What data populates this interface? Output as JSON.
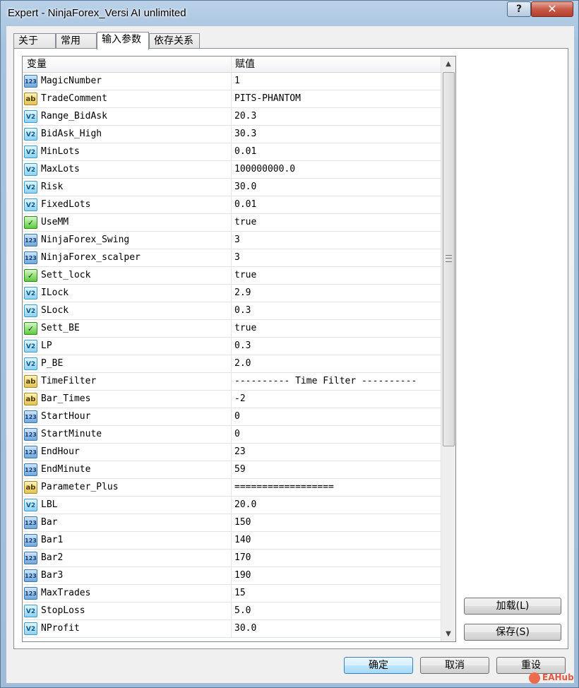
{
  "window": {
    "title": "Expert - NinjaForex_Versi AI unlimited",
    "help_label": "?",
    "close_label": "✕"
  },
  "tabs": [
    {
      "label": "关于"
    },
    {
      "label": "常用"
    },
    {
      "label": "输入参数",
      "active": true
    },
    {
      "label": "依存关系"
    }
  ],
  "grid": {
    "header": {
      "variable": "变量",
      "value": "赋值"
    },
    "rows": [
      {
        "type": "int",
        "icon": "123",
        "name": "MagicNumber",
        "value": "1"
      },
      {
        "type": "str",
        "icon": "ab",
        "name": "TradeComment",
        "value": "PITS-PHANTOM"
      },
      {
        "type": "dbl",
        "icon": "V2",
        "name": "Range_BidAsk",
        "value": "20.3"
      },
      {
        "type": "dbl",
        "icon": "V2",
        "name": "BidAsk_High",
        "value": "30.3"
      },
      {
        "type": "dbl",
        "icon": "V2",
        "name": "MinLots",
        "value": "0.01"
      },
      {
        "type": "dbl",
        "icon": "V2",
        "name": "MaxLots",
        "value": "100000000.0"
      },
      {
        "type": "dbl",
        "icon": "V2",
        "name": "Risk",
        "value": "30.0"
      },
      {
        "type": "dbl",
        "icon": "V2",
        "name": "FixedLots",
        "value": "0.01"
      },
      {
        "type": "bool",
        "icon": "✓",
        "name": "UseMM",
        "value": "true"
      },
      {
        "type": "int",
        "icon": "123",
        "name": "NinjaForex_Swing",
        "value": "3"
      },
      {
        "type": "int",
        "icon": "123",
        "name": "NinjaForex_scalper",
        "value": "3"
      },
      {
        "type": "bool",
        "icon": "✓",
        "name": "Sett_lock",
        "value": "true"
      },
      {
        "type": "dbl",
        "icon": "V2",
        "name": "ILock",
        "value": "2.9"
      },
      {
        "type": "dbl",
        "icon": "V2",
        "name": "SLock",
        "value": "0.3"
      },
      {
        "type": "bool",
        "icon": "✓",
        "name": "Sett_BE",
        "value": "true"
      },
      {
        "type": "dbl",
        "icon": "V2",
        "name": "LP",
        "value": "0.3"
      },
      {
        "type": "dbl",
        "icon": "V2",
        "name": "P_BE",
        "value": "2.0"
      },
      {
        "type": "str",
        "icon": "ab",
        "name": "TimeFilter",
        "value": "---------- Time Filter ----------"
      },
      {
        "type": "str",
        "icon": "ab",
        "name": "Bar_Times",
        "value": "-2"
      },
      {
        "type": "int",
        "icon": "123",
        "name": "StartHour",
        "value": "0"
      },
      {
        "type": "int",
        "icon": "123",
        "name": "StartMinute",
        "value": "0"
      },
      {
        "type": "int",
        "icon": "123",
        "name": "EndHour",
        "value": "23"
      },
      {
        "type": "int",
        "icon": "123",
        "name": "EndMinute",
        "value": "59"
      },
      {
        "type": "str",
        "icon": "ab",
        "name": "Parameter_Plus",
        "value": "=================="
      },
      {
        "type": "dbl",
        "icon": "V2",
        "name": "LBL",
        "value": "20.0"
      },
      {
        "type": "int",
        "icon": "123",
        "name": "Bar",
        "value": "150"
      },
      {
        "type": "int",
        "icon": "123",
        "name": "Bar1",
        "value": "140"
      },
      {
        "type": "int",
        "icon": "123",
        "name": "Bar2",
        "value": "170"
      },
      {
        "type": "int",
        "icon": "123",
        "name": "Bar3",
        "value": "190"
      },
      {
        "type": "int",
        "icon": "123",
        "name": "MaxTrades",
        "value": "15"
      },
      {
        "type": "dbl",
        "icon": "V2",
        "name": "StopLoss",
        "value": "5.0"
      },
      {
        "type": "dbl",
        "icon": "V2",
        "name": "NProfit",
        "value": "30.0"
      }
    ]
  },
  "side_buttons": {
    "load": "加载(L)",
    "save": "保存(S)"
  },
  "footer_buttons": {
    "ok": "确定",
    "cancel": "取消",
    "reset": "重设"
  },
  "watermark": "EAHub"
}
